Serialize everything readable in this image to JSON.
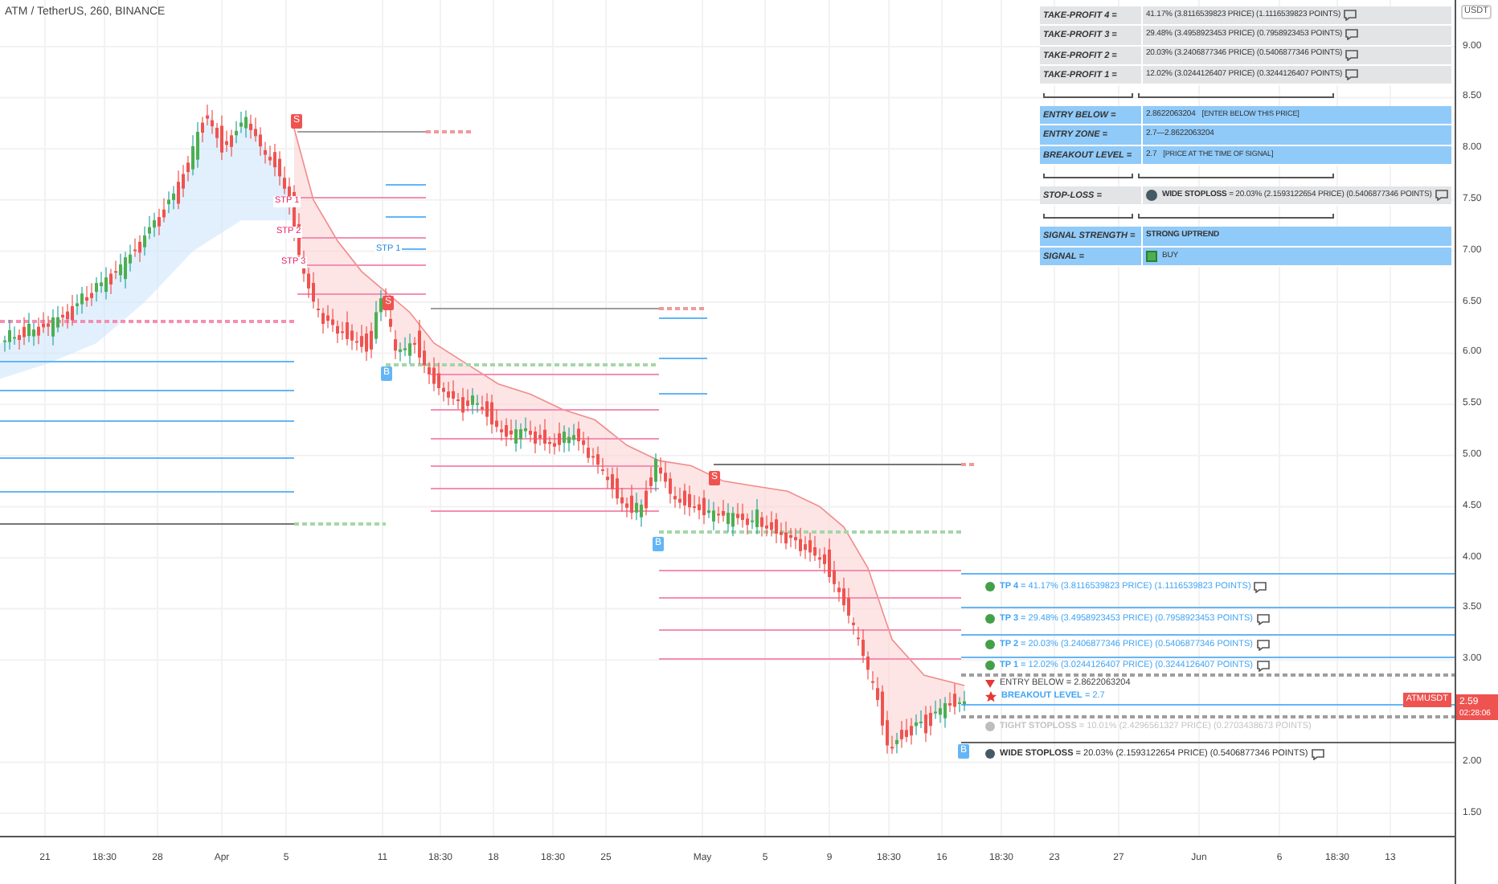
{
  "header": {
    "title": "ATM / TetherUS, 260, BINANCE"
  },
  "info_table": {
    "sections": [
      {
        "kind": "gray",
        "rows": [
          {
            "label": "TAKE-PROFIT 4 =",
            "value": "41.17% (3.8116539823 PRICE) (1.1116539823 POINTS)",
            "comment": true
          },
          {
            "label": "TAKE-PROFIT 3 =",
            "value": "29.48% (3.4958923453 PRICE) (0.7958923453 POINTS)",
            "comment": true
          },
          {
            "label": "TAKE-PROFIT 2 =",
            "value": "20.03% (3.2406877346 PRICE) (0.5406877346 POINTS)",
            "comment": true
          },
          {
            "label": "TAKE-PROFIT 1 =",
            "value": "12.02% (3.0244126407 PRICE) (0.3244126407 POINTS)",
            "comment": true
          }
        ]
      },
      {
        "kind": "blue",
        "rows": [
          {
            "label": "ENTRY BELOW =",
            "value": "2.8622063204",
            "note": "[ENTER BELOW THIS PRICE]",
            "comment": false
          },
          {
            "label": "ENTRY ZONE =",
            "value": "2.7—2.8622063204",
            "comment": false
          },
          {
            "label": "BREAKOUT LEVEL =",
            "value": "2.7",
            "note": "[PRICE AT THE TIME OF SIGNAL]",
            "comment": false
          }
        ]
      },
      {
        "kind": "gray",
        "rows": [
          {
            "label": "STOP-LOSS =",
            "value": "**WIDE STOPLOSS** = 20.03% (2.1593122654 PRICE) (0.5406877346 POINTS)",
            "kind": "stoploss",
            "comment": true
          }
        ]
      },
      {
        "kind": "blue",
        "rows": [
          {
            "label": "SIGNAL STRENGTH =",
            "value": "**STRONG UPTREND**",
            "comment": false
          },
          {
            "label": "SIGNAL =",
            "value": "BUY",
            "kind": "signal",
            "comment": false
          }
        ]
      }
    ]
  },
  "chart_labels": [
    {
      "kind": "tp",
      "text": "**TP 4** = 41.17% (3.8116539823 PRICE) (1.1116539823 POINTS)",
      "comment": true
    },
    {
      "kind": "tp",
      "text": "**TP 3** = 29.48% (3.4958923453 PRICE) (0.7958923453 POINTS)",
      "comment": true
    },
    {
      "kind": "tp",
      "text": "**TP 2** = 20.03% (3.2406877346 PRICE) (0.5406877346 POINTS)",
      "comment": true
    },
    {
      "kind": "tp",
      "text": "**TP 1** = 12.02% (3.0244126407 PRICE) (0.3244126407 POINTS)",
      "comment": true
    },
    {
      "kind": "entry",
      "text": "ENTRY BELOW = 2.8622063204",
      "comment": false
    },
    {
      "kind": "breakout",
      "text": "**BREAKOUT LEVEL** = 2.7",
      "comment": false
    },
    {
      "kind": "tight",
      "text": "**TIGHT STOPLOSS** = 10.01% (2.4296561327 PRICE) (0.2703438673 POINTS)",
      "comment": false
    },
    {
      "kind": "wide",
      "text": "**WIDE STOPLOSS** = 20.03% (2.1593122654 PRICE) (0.5406877346 POINTS)",
      "comment": true
    }
  ],
  "markers": [
    {
      "kind": "sell",
      "label": "S"
    },
    {
      "kind": "sell",
      "label": "S"
    },
    {
      "kind": "sell",
      "label": "S"
    },
    {
      "kind": "buy",
      "label": "B"
    },
    {
      "kind": "buy",
      "label": "B"
    },
    {
      "kind": "buy",
      "label": "B"
    },
    {
      "kind": "stop-buy",
      "label": "STP 1"
    },
    {
      "kind": "stop-sell",
      "label": "STP 1"
    },
    {
      "kind": "stop-sell",
      "label": "STP 2"
    },
    {
      "kind": "stop-sell",
      "label": "STP 3"
    }
  ],
  "price_axis": {
    "currency": "USDT",
    "ticks": [
      "9.00",
      "8.50",
      "8.00",
      "7.50",
      "7.00",
      "6.50",
      "6.00",
      "5.50",
      "5.00",
      "4.50",
      "4.00",
      "3.50",
      "3.00",
      "2.00",
      "1.50"
    ],
    "last_price": {
      "symbol": "ATMUSDT",
      "price": "2.59",
      "countdown": "02:28:06"
    }
  },
  "time_axis": {
    "ticks": [
      "21",
      "18:30",
      "28",
      "Apr",
      "5",
      "11",
      "18:30",
      "18",
      "18:30",
      "25",
      "May",
      "5",
      "9",
      "18:30",
      "16",
      "18:30",
      "23",
      "27",
      "Jun",
      "6",
      "18:30",
      "13"
    ]
  }
}
